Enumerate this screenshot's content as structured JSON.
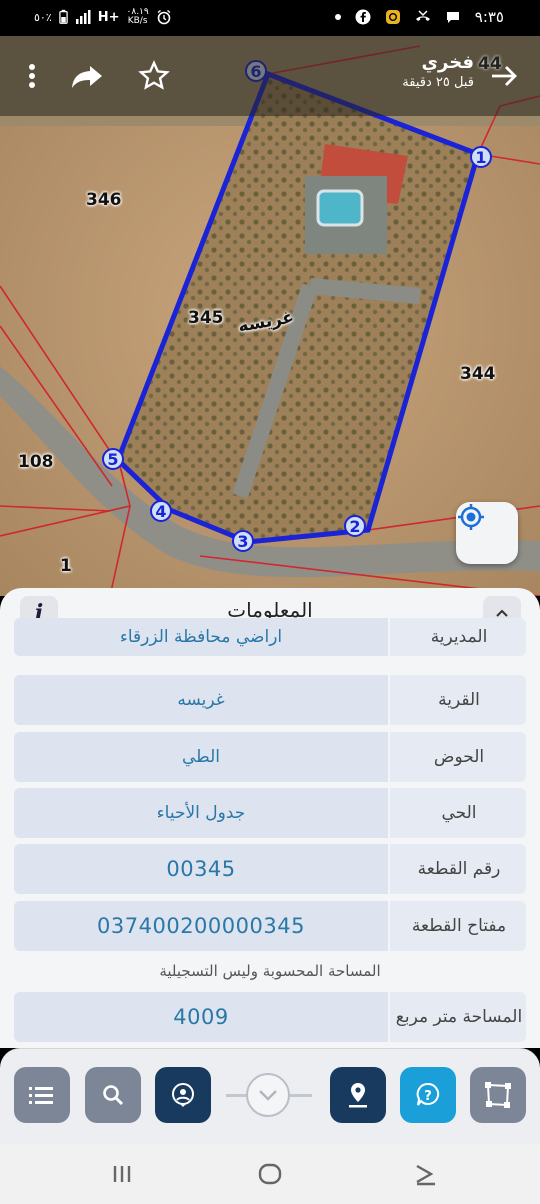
{
  "status_bar": {
    "left_text": "٥٠٪",
    "network": "H+",
    "speed": "٠٨.١٩",
    "speed_unit": "KB/s",
    "time": "٩:٣٥"
  },
  "header": {
    "title": "فخري",
    "subtitle": "قبل ٢٥ دقيقة",
    "icons": [
      "more-vert-icon",
      "share-icon",
      "star-icon",
      "back-arrow-icon"
    ]
  },
  "map": {
    "parcel_labels": [
      "346",
      "345",
      "344",
      "108",
      "1",
      "44"
    ],
    "village_label": "غريسه",
    "vertices": [
      "1",
      "2",
      "3",
      "4",
      "5",
      "6"
    ],
    "colors": {
      "boundary": "#1a23d6",
      "cadastre": "#d0282c",
      "vertex_fill": "#cfe0f5"
    }
  },
  "panel": {
    "title": "المعلومات",
    "rows": [
      {
        "label": "المديرية",
        "value": "اراضي محافظة الزرقاء"
      },
      {
        "label": "القرية",
        "value": "غريسه"
      },
      {
        "label": "الحوض",
        "value": "الطي"
      },
      {
        "label": "الحي",
        "value": "جدول الأحياء"
      },
      {
        "label": "رقم القطعة",
        "value": "00345"
      },
      {
        "label": "مفتاح القطعة",
        "value": "037400200000345"
      }
    ],
    "note": "المساحة المحسوبة وليس التسجيلية",
    "area_row": {
      "label": "المساحة متر مربع",
      "value": "4009"
    }
  },
  "actionbar": {
    "buttons": [
      "list-icon",
      "search-icon",
      "user-location-icon",
      "chevron-down-icon",
      "map-pin-icon",
      "help-icon",
      "polygon-select-icon"
    ]
  },
  "navbar": {
    "buttons": [
      "recent-apps-icon",
      "home-icon",
      "back-icon"
    ]
  }
}
